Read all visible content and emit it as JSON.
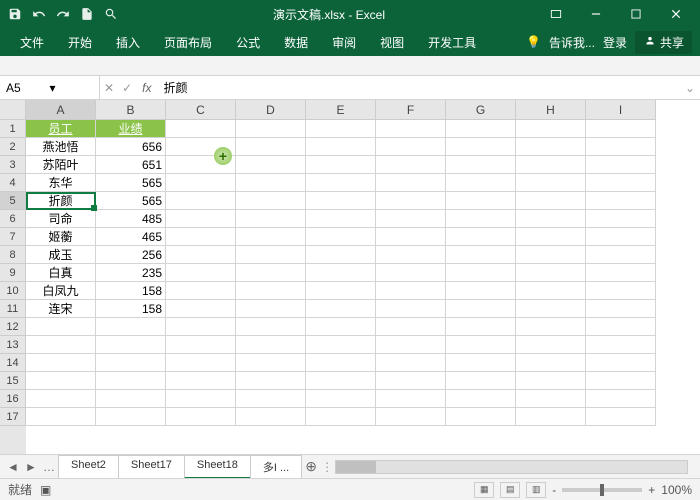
{
  "titlebar": {
    "title": "演示文稿.xlsx - Excel"
  },
  "ribbon": {
    "tabs": [
      "文件",
      "开始",
      "插入",
      "页面布局",
      "公式",
      "数据",
      "审阅",
      "视图",
      "开发工具"
    ],
    "tell_me": "告诉我...",
    "signin": "登录",
    "share": "共享"
  },
  "namebox": {
    "ref": "A5"
  },
  "formula_bar": {
    "fx": "fx",
    "value": "折颜"
  },
  "columns": [
    "A",
    "B",
    "C",
    "D",
    "E",
    "F",
    "G",
    "H",
    "I"
  ],
  "selected_col": "A",
  "selected_row": 5,
  "rows": [
    1,
    2,
    3,
    4,
    5,
    6,
    7,
    8,
    9,
    10,
    11,
    12,
    13,
    14,
    15,
    16,
    17
  ],
  "headers": {
    "A": "员工",
    "B": "业绩"
  },
  "data": [
    {
      "A": "燕池悟",
      "B": 656
    },
    {
      "A": "苏陌叶",
      "B": 651
    },
    {
      "A": "东华",
      "B": 565
    },
    {
      "A": "折颜",
      "B": 565
    },
    {
      "A": "司命",
      "B": 485
    },
    {
      "A": "姬蘅",
      "B": 465
    },
    {
      "A": "成玉",
      "B": 256
    },
    {
      "A": "白真",
      "B": 235
    },
    {
      "A": "白凤九",
      "B": 158
    },
    {
      "A": "连宋",
      "B": 158
    }
  ],
  "sheets": {
    "tabs": [
      "Sheet2",
      "Sheet17",
      "Sheet18",
      "多I ..."
    ],
    "active": "Sheet18"
  },
  "statusbar": {
    "ready": "就绪",
    "rec": "",
    "zoom": "100%",
    "minus": "-",
    "plus": "+"
  }
}
